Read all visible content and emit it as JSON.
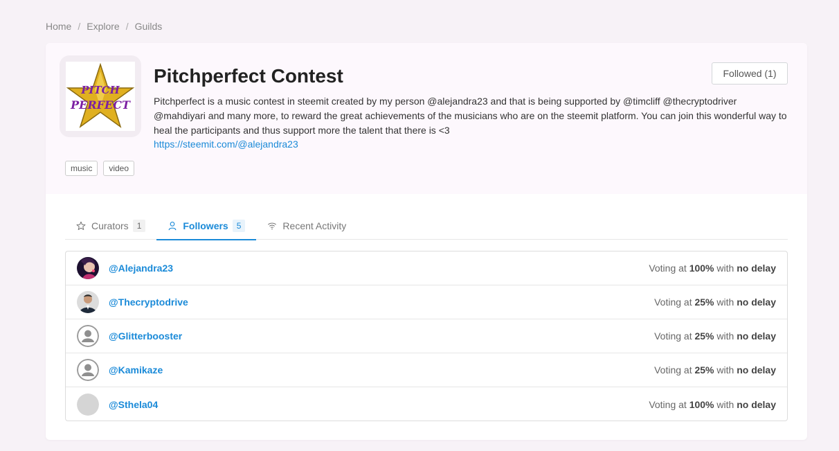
{
  "breadcrumb": {
    "items": [
      "Home",
      "Explore",
      "Guilds"
    ],
    "separator": "/"
  },
  "guild": {
    "title": "Pitchperfect Contest",
    "logo_text_1": "PITCH",
    "logo_text_2": "PERFECT",
    "description": "Pitchperfect is a music contest in steemit created by my person @alejandra23 and that is being supported by @timcliff @thecryptodriver @mahdiyari and many more, to reward the great achievements of the musicians who are on the steemit platform. You can join this wonderful way to heal the participants and thus support more the talent that there is <3",
    "link": "https://steemit.com/@alejandra23",
    "follow_button": "Followed (1)",
    "tags": [
      "music",
      "video"
    ]
  },
  "tabs": [
    {
      "label": "Curators",
      "count": "1",
      "icon": "star-icon",
      "active": false
    },
    {
      "label": "Followers",
      "count": "5",
      "icon": "user-icon",
      "active": true
    },
    {
      "label": "Recent Activity",
      "count": "",
      "icon": "wifi-icon",
      "active": false
    }
  ],
  "followers": [
    {
      "name": "@Alejandra23",
      "prefix": "Voting at",
      "percent": "100%",
      "mid": "with",
      "delay": "no delay",
      "avatar": "photo-woman"
    },
    {
      "name": "@Thecryptodrive",
      "prefix": "Voting at",
      "percent": "25%",
      "mid": "with",
      "delay": "no delay",
      "avatar": "photo-man"
    },
    {
      "name": "@Glitterbooster",
      "prefix": "Voting at",
      "percent": "25%",
      "mid": "with",
      "delay": "no delay",
      "avatar": "default-user-icon"
    },
    {
      "name": "@Kamikaze",
      "prefix": "Voting at",
      "percent": "25%",
      "mid": "with",
      "delay": "no delay",
      "avatar": "default-user-icon"
    },
    {
      "name": "@Sthela04",
      "prefix": "Voting at",
      "percent": "100%",
      "mid": "with",
      "delay": "no delay",
      "avatar": "blank-circle"
    }
  ],
  "colors": {
    "accent": "#1a8ad8",
    "page_bg": "#f7f2f7",
    "header_bg": "#fdf8fd",
    "star_gold": "#e0b020",
    "logo_text": "#7b1fa2"
  }
}
